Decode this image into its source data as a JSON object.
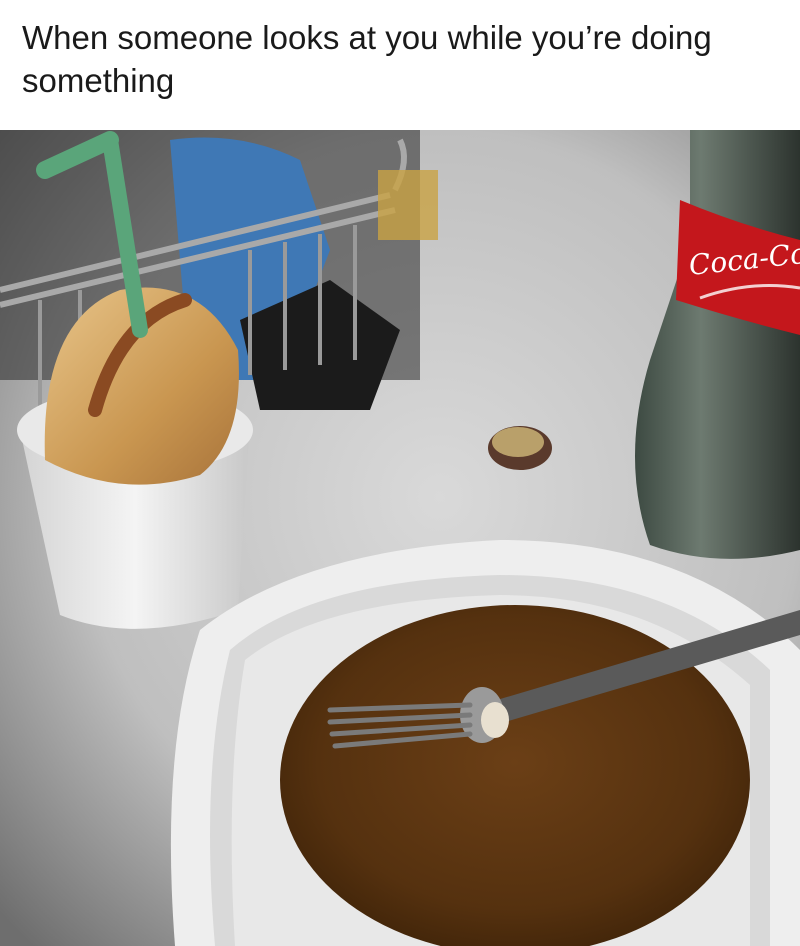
{
  "meme": {
    "caption": "When someone looks at you while you’re doing something"
  },
  "photo": {
    "bottle_label": "Coca-Cola",
    "colors": {
      "counter": "#cfcfcf",
      "soda": "#4a2a0e",
      "label_red": "#c4171c",
      "straw": "#5aa57a"
    }
  }
}
